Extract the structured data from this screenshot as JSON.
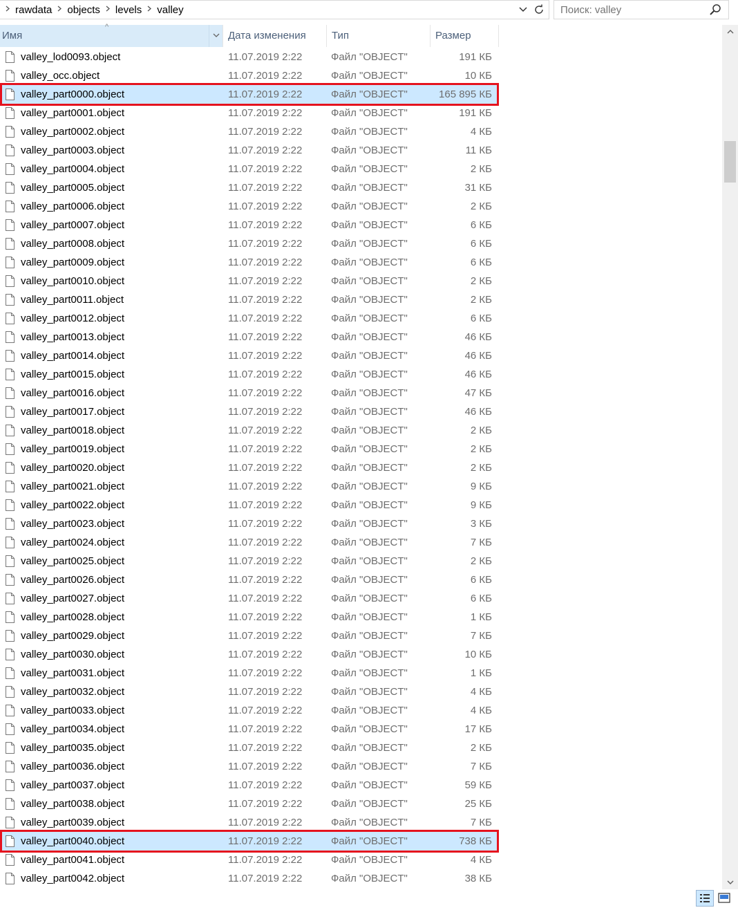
{
  "breadcrumb": [
    "rawdata",
    "objects",
    "levels",
    "valley"
  ],
  "search": {
    "placeholder": "Поиск: valley"
  },
  "columns": {
    "name": "Имя",
    "date": "Дата изменения",
    "type": "Тип",
    "size": "Размер"
  },
  "files": [
    {
      "name": "valley_lod0093.object",
      "date": "11.07.2019 2:22",
      "type": "Файл \"OBJECT\"",
      "size": "191 КБ"
    },
    {
      "name": "valley_occ.object",
      "date": "11.07.2019 2:22",
      "type": "Файл \"OBJECT\"",
      "size": "10 КБ"
    },
    {
      "name": "valley_part0000.object",
      "date": "11.07.2019 2:22",
      "type": "Файл \"OBJECT\"",
      "size": "165 895 КБ",
      "selected": true,
      "highlighted": true
    },
    {
      "name": "valley_part0001.object",
      "date": "11.07.2019 2:22",
      "type": "Файл \"OBJECT\"",
      "size": "191 КБ"
    },
    {
      "name": "valley_part0002.object",
      "date": "11.07.2019 2:22",
      "type": "Файл \"OBJECT\"",
      "size": "4 КБ"
    },
    {
      "name": "valley_part0003.object",
      "date": "11.07.2019 2:22",
      "type": "Файл \"OBJECT\"",
      "size": "11 КБ"
    },
    {
      "name": "valley_part0004.object",
      "date": "11.07.2019 2:22",
      "type": "Файл \"OBJECT\"",
      "size": "2 КБ"
    },
    {
      "name": "valley_part0005.object",
      "date": "11.07.2019 2:22",
      "type": "Файл \"OBJECT\"",
      "size": "31 КБ"
    },
    {
      "name": "valley_part0006.object",
      "date": "11.07.2019 2:22",
      "type": "Файл \"OBJECT\"",
      "size": "2 КБ"
    },
    {
      "name": "valley_part0007.object",
      "date": "11.07.2019 2:22",
      "type": "Файл \"OBJECT\"",
      "size": "6 КБ"
    },
    {
      "name": "valley_part0008.object",
      "date": "11.07.2019 2:22",
      "type": "Файл \"OBJECT\"",
      "size": "6 КБ"
    },
    {
      "name": "valley_part0009.object",
      "date": "11.07.2019 2:22",
      "type": "Файл \"OBJECT\"",
      "size": "6 КБ"
    },
    {
      "name": "valley_part0010.object",
      "date": "11.07.2019 2:22",
      "type": "Файл \"OBJECT\"",
      "size": "2 КБ"
    },
    {
      "name": "valley_part0011.object",
      "date": "11.07.2019 2:22",
      "type": "Файл \"OBJECT\"",
      "size": "2 КБ"
    },
    {
      "name": "valley_part0012.object",
      "date": "11.07.2019 2:22",
      "type": "Файл \"OBJECT\"",
      "size": "6 КБ"
    },
    {
      "name": "valley_part0013.object",
      "date": "11.07.2019 2:22",
      "type": "Файл \"OBJECT\"",
      "size": "46 КБ"
    },
    {
      "name": "valley_part0014.object",
      "date": "11.07.2019 2:22",
      "type": "Файл \"OBJECT\"",
      "size": "46 КБ"
    },
    {
      "name": "valley_part0015.object",
      "date": "11.07.2019 2:22",
      "type": "Файл \"OBJECT\"",
      "size": "46 КБ"
    },
    {
      "name": "valley_part0016.object",
      "date": "11.07.2019 2:22",
      "type": "Файл \"OBJECT\"",
      "size": "47 КБ"
    },
    {
      "name": "valley_part0017.object",
      "date": "11.07.2019 2:22",
      "type": "Файл \"OBJECT\"",
      "size": "46 КБ"
    },
    {
      "name": "valley_part0018.object",
      "date": "11.07.2019 2:22",
      "type": "Файл \"OBJECT\"",
      "size": "2 КБ"
    },
    {
      "name": "valley_part0019.object",
      "date": "11.07.2019 2:22",
      "type": "Файл \"OBJECT\"",
      "size": "2 КБ"
    },
    {
      "name": "valley_part0020.object",
      "date": "11.07.2019 2:22",
      "type": "Файл \"OBJECT\"",
      "size": "2 КБ"
    },
    {
      "name": "valley_part0021.object",
      "date": "11.07.2019 2:22",
      "type": "Файл \"OBJECT\"",
      "size": "9 КБ"
    },
    {
      "name": "valley_part0022.object",
      "date": "11.07.2019 2:22",
      "type": "Файл \"OBJECT\"",
      "size": "9 КБ"
    },
    {
      "name": "valley_part0023.object",
      "date": "11.07.2019 2:22",
      "type": "Файл \"OBJECT\"",
      "size": "3 КБ"
    },
    {
      "name": "valley_part0024.object",
      "date": "11.07.2019 2:22",
      "type": "Файл \"OBJECT\"",
      "size": "7 КБ"
    },
    {
      "name": "valley_part0025.object",
      "date": "11.07.2019 2:22",
      "type": "Файл \"OBJECT\"",
      "size": "2 КБ"
    },
    {
      "name": "valley_part0026.object",
      "date": "11.07.2019 2:22",
      "type": "Файл \"OBJECT\"",
      "size": "6 КБ"
    },
    {
      "name": "valley_part0027.object",
      "date": "11.07.2019 2:22",
      "type": "Файл \"OBJECT\"",
      "size": "6 КБ"
    },
    {
      "name": "valley_part0028.object",
      "date": "11.07.2019 2:22",
      "type": "Файл \"OBJECT\"",
      "size": "1 КБ"
    },
    {
      "name": "valley_part0029.object",
      "date": "11.07.2019 2:22",
      "type": "Файл \"OBJECT\"",
      "size": "7 КБ"
    },
    {
      "name": "valley_part0030.object",
      "date": "11.07.2019 2:22",
      "type": "Файл \"OBJECT\"",
      "size": "10 КБ"
    },
    {
      "name": "valley_part0031.object",
      "date": "11.07.2019 2:22",
      "type": "Файл \"OBJECT\"",
      "size": "1 КБ"
    },
    {
      "name": "valley_part0032.object",
      "date": "11.07.2019 2:22",
      "type": "Файл \"OBJECT\"",
      "size": "4 КБ"
    },
    {
      "name": "valley_part0033.object",
      "date": "11.07.2019 2:22",
      "type": "Файл \"OBJECT\"",
      "size": "4 КБ"
    },
    {
      "name": "valley_part0034.object",
      "date": "11.07.2019 2:22",
      "type": "Файл \"OBJECT\"",
      "size": "17 КБ"
    },
    {
      "name": "valley_part0035.object",
      "date": "11.07.2019 2:22",
      "type": "Файл \"OBJECT\"",
      "size": "2 КБ"
    },
    {
      "name": "valley_part0036.object",
      "date": "11.07.2019 2:22",
      "type": "Файл \"OBJECT\"",
      "size": "7 КБ"
    },
    {
      "name": "valley_part0037.object",
      "date": "11.07.2019 2:22",
      "type": "Файл \"OBJECT\"",
      "size": "59 КБ"
    },
    {
      "name": "valley_part0038.object",
      "date": "11.07.2019 2:22",
      "type": "Файл \"OBJECT\"",
      "size": "25 КБ"
    },
    {
      "name": "valley_part0039.object",
      "date": "11.07.2019 2:22",
      "type": "Файл \"OBJECT\"",
      "size": "7 КБ"
    },
    {
      "name": "valley_part0040.object",
      "date": "11.07.2019 2:22",
      "type": "Файл \"OBJECT\"",
      "size": "738 КБ",
      "selected": true,
      "highlighted": true
    },
    {
      "name": "valley_part0041.object",
      "date": "11.07.2019 2:22",
      "type": "Файл \"OBJECT\"",
      "size": "4 КБ"
    },
    {
      "name": "valley_part0042.object",
      "date": "11.07.2019 2:22",
      "type": "Файл \"OBJECT\"",
      "size": "38 КБ"
    }
  ],
  "colors": {
    "selection": "#cce8ff",
    "highlight_border": "#e5131e",
    "header_active": "#d9ebf9"
  },
  "icons": {
    "file": "file-icon",
    "search": "search-icon",
    "refresh": "refresh-icon",
    "view_details": "details-view-icon",
    "view_large": "large-icons-view-icon"
  }
}
